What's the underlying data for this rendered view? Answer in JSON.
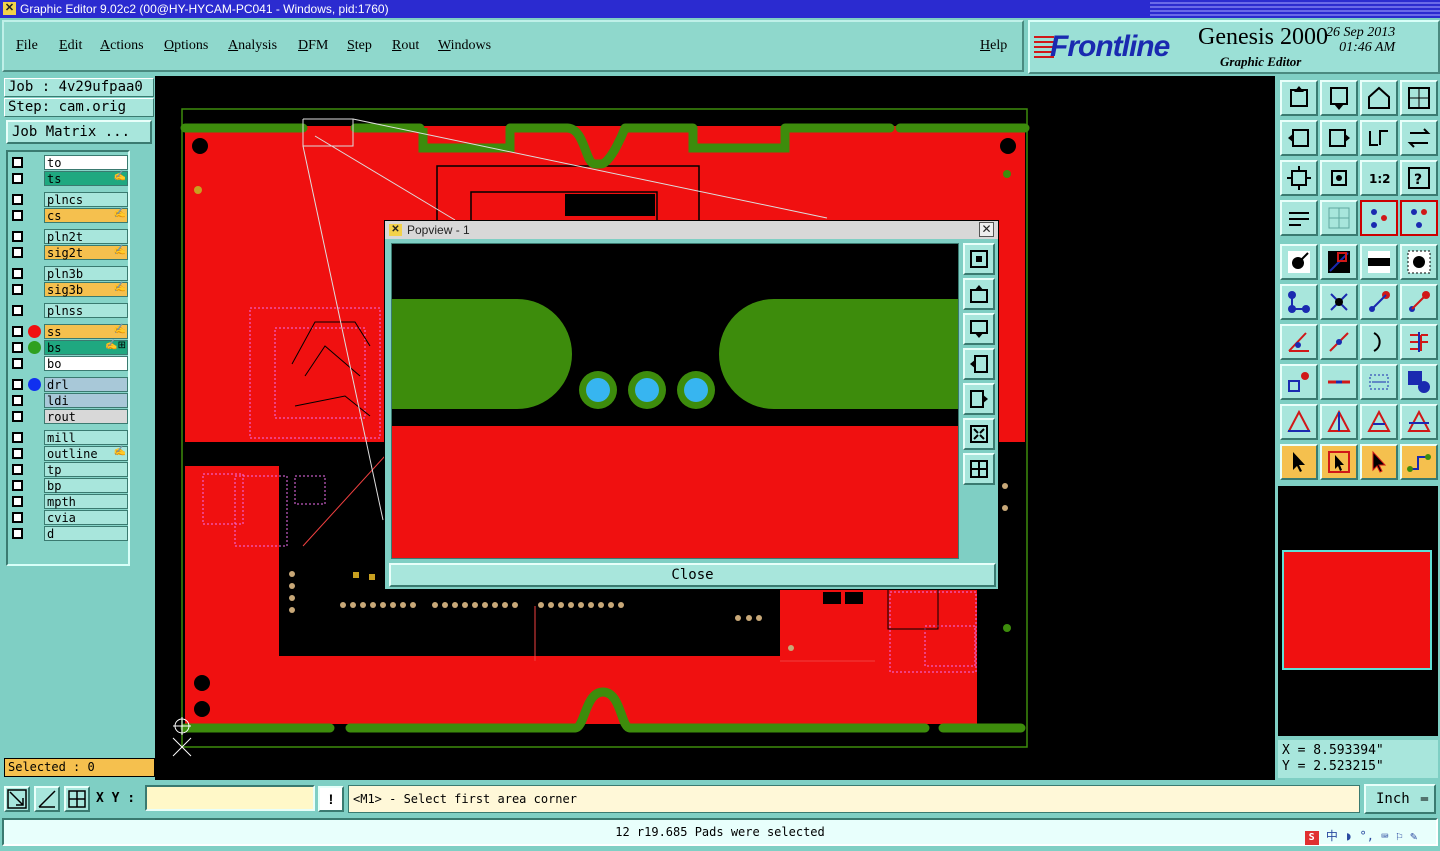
{
  "window": {
    "title": "Graphic Editor 9.02c2 (00@HY-HYCAM-PC041 - Windows, pid:1760)"
  },
  "menu": [
    {
      "label": "File"
    },
    {
      "label": "Edit"
    },
    {
      "label": "Actions"
    },
    {
      "label": "Options"
    },
    {
      "label": "Analysis"
    },
    {
      "label": "DFM"
    },
    {
      "label": "Step"
    },
    {
      "label": "Rout"
    },
    {
      "label": "Windows"
    },
    {
      "label": "Help"
    }
  ],
  "brand": {
    "logo": "Frontline",
    "product": "Genesis 2000",
    "subtitle": "Graphic Editor",
    "date": "26 Sep 2013",
    "time": "01:46 AM"
  },
  "job": {
    "job_line": "Job : 4v29ufpaa0",
    "step_line": "Step: cam.orig",
    "matrix_button": "Job Matrix ..."
  },
  "layers": [
    {
      "name": "to",
      "bg": "#ffffff"
    },
    {
      "name": "ts",
      "bg": "#1fa880",
      "mark": "✍"
    },
    {
      "name": "plncs",
      "bg": "#a8e6dc"
    },
    {
      "name": "cs",
      "bg": "#f5c04e",
      "mark": "✍"
    },
    {
      "name": "pln2t",
      "bg": "#a8e6dc"
    },
    {
      "name": "sig2t",
      "bg": "#f5c04e",
      "mark": "✍"
    },
    {
      "name": "pln3b",
      "bg": "#a8e6dc"
    },
    {
      "name": "sig3b",
      "bg": "#f5c04e",
      "mark": "✍"
    },
    {
      "name": "plnss",
      "bg": "#a8e6dc"
    },
    {
      "name": "ss",
      "bg": "#f5c04e",
      "mark": "✍",
      "dot": "#f01010"
    },
    {
      "name": "bs",
      "bg": "#1fa880",
      "mark": "✍⊞",
      "dot": "#2fa020"
    },
    {
      "name": "bo",
      "bg": "#ffffff"
    },
    {
      "name": "drl",
      "bg": "#a8c8d8",
      "dot": "#1030f0"
    },
    {
      "name": "ldi",
      "bg": "#a8c8d8"
    },
    {
      "name": "rout",
      "bg": "#d8d8d8"
    },
    {
      "name": "mill",
      "bg": "#a8e6dc"
    },
    {
      "name": "outline",
      "bg": "#a8e6dc",
      "mark": "✍"
    },
    {
      "name": "tp",
      "bg": "#a8e6dc"
    },
    {
      "name": "bp",
      "bg": "#a8e6dc"
    },
    {
      "name": "mpth",
      "bg": "#a8e6dc"
    },
    {
      "name": "cvia",
      "bg": "#a8e6dc"
    },
    {
      "name": "d",
      "bg": "#a8e6dc"
    }
  ],
  "selected": "Selected : 0",
  "popview": {
    "title": "Popview - 1",
    "close_label": "Close"
  },
  "coords": {
    "x": "X = 8.593394\"",
    "y": "Y = 2.523215\""
  },
  "bottom": {
    "xy_label": "X Y :",
    "xy_value": "",
    "warn": "!",
    "prompt": "<M1> - Select first area corner",
    "unit": "Inch"
  },
  "status": "12 r19.685 Pads were selected",
  "colors": {
    "copper_red": "#f01010",
    "mask_green": "#3d8c0c",
    "pad_blue": "#37b5f0",
    "panel_teal": "#7fcfc4"
  }
}
